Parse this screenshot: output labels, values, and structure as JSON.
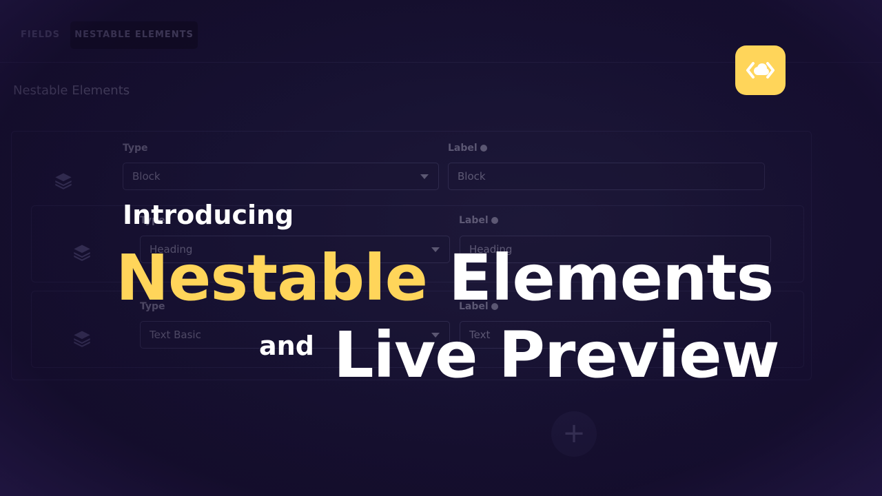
{
  "tabs": [
    {
      "label": "FIELDS"
    },
    {
      "label": "NESTABLE ELEMENTS"
    }
  ],
  "section_title": "Nestable Elements",
  "elements": [
    {
      "type_label": "Type",
      "type_value": "Block",
      "label_label": "Label",
      "label_value": "Block"
    },
    {
      "type_label": "Type",
      "type_value": "Heading",
      "label_label": "Label",
      "label_value": "Heading"
    },
    {
      "type_label": "Type",
      "type_value": "Text Basic",
      "label_label": "Label",
      "label_value": "Text"
    }
  ],
  "add_button": "+",
  "headline": {
    "intro": "Introducing",
    "title_highlight": "Nestable",
    "title_rest": "Elements",
    "connector": "and",
    "subtitle": "Live Preview"
  },
  "colors": {
    "accent": "#ffd55a",
    "background": "#171232",
    "text": "#ffffff"
  },
  "icons": {
    "logo": "code-brackets-cloud-logo",
    "element": "layers-icon",
    "add": "plus-icon",
    "dropdown": "chevron-down-icon",
    "info": "info-icon"
  }
}
